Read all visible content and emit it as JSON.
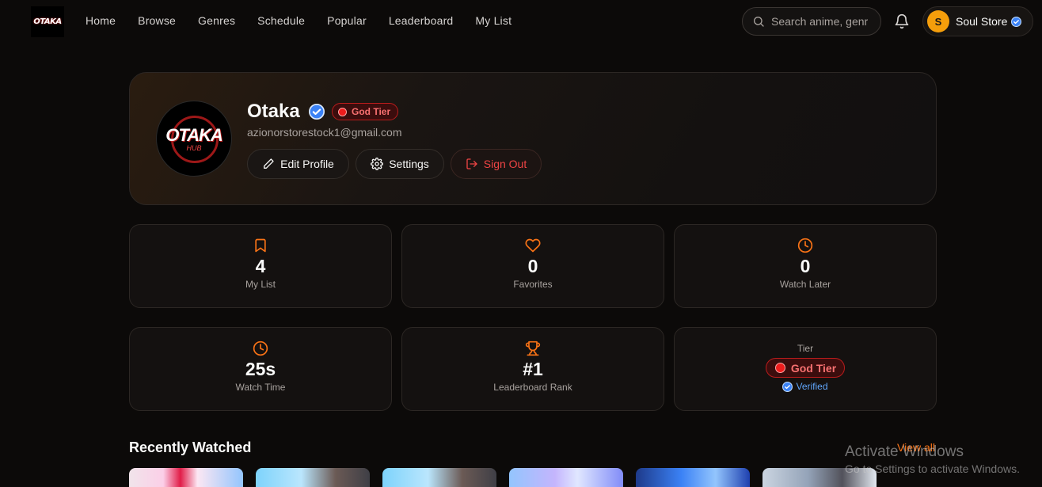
{
  "nav": {
    "logo_text": "OTAKA",
    "links": [
      "Home",
      "Browse",
      "Genres",
      "Schedule",
      "Popular",
      "Leaderboard",
      "My List"
    ],
    "search_placeholder": "Search anime, genr",
    "user": {
      "initial": "S",
      "name": "Soul Store"
    }
  },
  "profile": {
    "avatar_title": "OTAKA",
    "avatar_subtitle": "HUB",
    "name": "Otaka",
    "tier": "God Tier",
    "email": "azionorstorestock1@gmail.com",
    "buttons": {
      "edit": "Edit Profile",
      "settings": "Settings",
      "signout": "Sign Out"
    }
  },
  "stats": [
    {
      "icon": "bookmark-icon",
      "value": "4",
      "label": "My List"
    },
    {
      "icon": "heart-icon",
      "value": "0",
      "label": "Favorites"
    },
    {
      "icon": "clock-icon",
      "value": "0",
      "label": "Watch Later"
    },
    {
      "icon": "clock-icon",
      "value": "25s",
      "label": "Watch Time"
    },
    {
      "icon": "trophy-icon",
      "value": "#1",
      "label": "Leaderboard Rank"
    }
  ],
  "tier_card": {
    "label": "Tier",
    "tier": "God Tier",
    "verified": "Verified"
  },
  "recently_watched": {
    "title": "Recently Watched",
    "view_all": "View all"
  },
  "watermark": {
    "line1": "Activate Windows",
    "line2": "Go to Settings to activate Windows."
  },
  "colors": {
    "accent": "#f97316",
    "tier_red": "#ef4444",
    "verified_blue": "#3b82f6",
    "background": "#0c0a09"
  }
}
